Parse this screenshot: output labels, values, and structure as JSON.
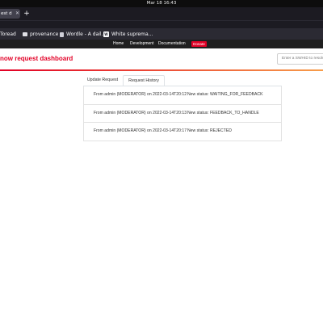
{
  "os": {
    "clock": "Mar 18  16:43"
  },
  "browser": {
    "tab_title": "est d",
    "tab_close": "✕",
    "new_tab": "+",
    "bookmarks": [
      {
        "label": "Toread",
        "icon": "folder-icon"
      },
      {
        "label": "provenance",
        "icon": "folder-icon"
      },
      {
        "label": "Wordle - A dail...",
        "icon": "document-icon"
      },
      {
        "label": "White suprema...",
        "icon": "wp-icon"
      }
    ]
  },
  "site_nav": {
    "home": "Home",
    "development": "Development",
    "documentation": "Documentation",
    "donate": "Donate"
  },
  "header": {
    "title": "now request dashboard",
    "search_placeholder": "Enter a SWHID to resolve"
  },
  "colors": {
    "accent": "#e20026",
    "accent_end": "#f79d4a",
    "nav_bg": "#1f1f1f"
  },
  "tabs": [
    {
      "label": "Update Request",
      "active": false
    },
    {
      "label": "Request History",
      "active": true
    }
  ],
  "history": [
    {
      "from": "From admin (MODERATOR) on 2022-03-14T20:12",
      "status": "New status: WAITING_FOR_FEEDBACK"
    },
    {
      "from": "From admin (MODERATOR) on 2022-03-14T20:13",
      "status": "New status: FEEDBACK_TO_HANDLE"
    },
    {
      "from": "From admin (MODERATOR) on 2022-03-14T20:17",
      "status": "New status: REJECTED"
    }
  ]
}
